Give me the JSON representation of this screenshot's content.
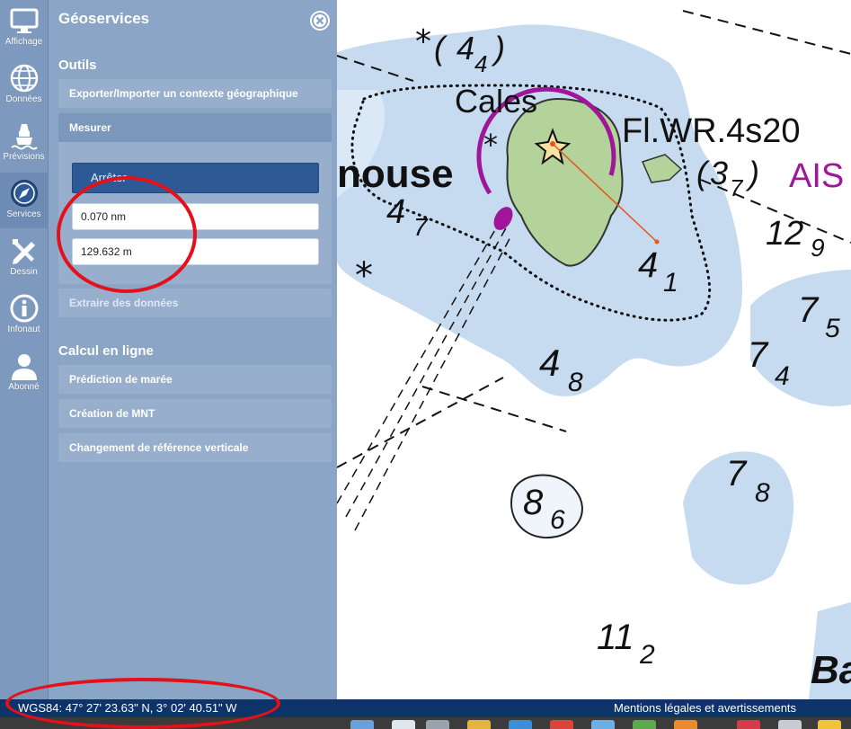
{
  "sidebar": {
    "items": [
      {
        "label": "Affichage",
        "icon": "monitor-icon"
      },
      {
        "label": "Données",
        "icon": "globe-icon"
      },
      {
        "label": "Prévisions",
        "icon": "buoy-icon"
      },
      {
        "label": "Services",
        "icon": "compass-icon"
      },
      {
        "label": "Dessin",
        "icon": "draw-tools-icon"
      },
      {
        "label": "Infonaut",
        "icon": "info-icon"
      },
      {
        "label": "Abonné",
        "icon": "user-icon"
      }
    ],
    "active_index": 3
  },
  "panel": {
    "title": "Géoservices",
    "outils_title": "Outils",
    "export_label": "Exporter/Importer un contexte géographique",
    "measure_label": "Mesurer",
    "stop_button": "Arrêter",
    "distance_nm": "0.070 nm",
    "distance_m": "129.632 m",
    "extract_label": "Extraire des données",
    "calc_title": "Calcul en ligne",
    "tide_label": "Prédiction de marée",
    "mnt_label": "Création de MNT",
    "ref_label": "Changement de référence verticale"
  },
  "map": {
    "place_name": "nouse",
    "islet": "Cales",
    "light": "Fl.WR.4s20",
    "ais": "AIS",
    "soundings": [
      {
        "main": "4",
        "sub": "4",
        "in_parens": true
      },
      {
        "main": "4",
        "sub": "7"
      },
      {
        "main": "3",
        "sub": "7",
        "in_parens": true
      },
      {
        "main": "12",
        "sub": "9"
      },
      {
        "main": "4",
        "sub": "1"
      },
      {
        "main": "7",
        "sub": "5"
      },
      {
        "main": "7",
        "sub": "4"
      },
      {
        "main": "4",
        "sub": "8"
      },
      {
        "main": "8",
        "sub": "6"
      },
      {
        "main": "7",
        "sub": "8"
      },
      {
        "main": "11",
        "sub": "2"
      }
    ],
    "edge_text": "Ba",
    "colors": {
      "shallow": "#c6dbf0",
      "deep": "#ffffff",
      "land": "#b3d39b",
      "magenta": "#a0169b"
    }
  },
  "footer": {
    "coordinates": "WGS84: 47° 27' 23.63\" N, 3° 02' 40.51\" W",
    "legal": "Mentions légales et avertissements"
  }
}
